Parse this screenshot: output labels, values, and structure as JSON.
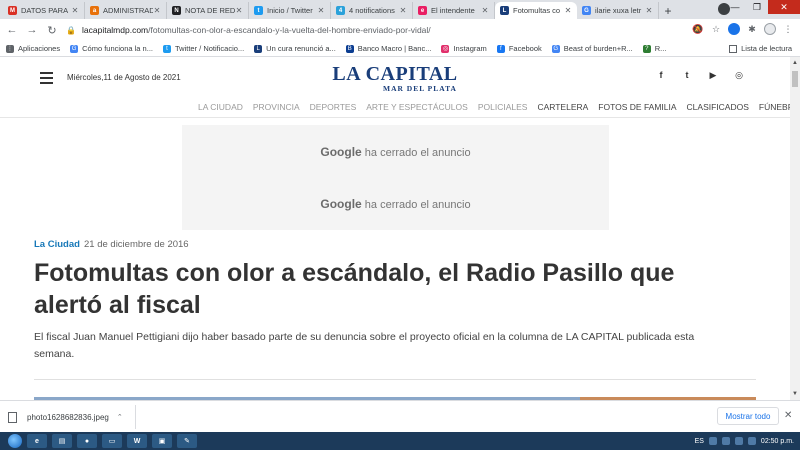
{
  "browser": {
    "tabs": [
      {
        "label": "DATOS PARA",
        "favicon_color": "#d93025",
        "favicon_char": "M",
        "active": false
      },
      {
        "label": "ADMINISTRAD",
        "favicon_color": "#e8710a",
        "favicon_char": "a",
        "active": false
      },
      {
        "label": "NOTA DE RED",
        "favicon_color": "#202124",
        "favicon_char": "N",
        "active": false
      },
      {
        "label": "Inicio / Twitter",
        "favicon_color": "#1d9bf0",
        "favicon_char": "t",
        "active": false
      },
      {
        "label": "4 notifications",
        "favicon_color": "#2aa1da",
        "favicon_char": "4",
        "active": false
      },
      {
        "label": "El intendente",
        "favicon_color": "#e91e63",
        "favicon_char": "e",
        "active": false
      },
      {
        "label": "Fotomultas co",
        "favicon_color": "#1a3e7a",
        "favicon_char": "L",
        "active": true
      },
      {
        "label": "ilarie xuxa letr",
        "favicon_color": "#4285f4",
        "favicon_char": "G",
        "active": false
      }
    ],
    "new_tab_label": "+",
    "url": {
      "host": "lacapitalmdp.com",
      "path": "/fotomultas-con-olor-a-escandalo-y-la-vuelta-del-hombre-enviado-por-vidal/"
    },
    "bookmarks": [
      {
        "label": "Aplicaciones",
        "color": "#5f6368",
        "char": "⋮"
      },
      {
        "label": "Cómo funciona la n...",
        "color": "#4285f4",
        "char": "G"
      },
      {
        "label": "Twitter / Notificacio...",
        "color": "#1d9bf0",
        "char": "t"
      },
      {
        "label": "Un cura renunció a...",
        "color": "#1a3e7a",
        "char": "L"
      },
      {
        "label": "Banco Macro | Banc...",
        "color": "#0b3d91",
        "char": "B"
      },
      {
        "label": "Instagram",
        "color": "#e1306c",
        "char": "◎"
      },
      {
        "label": "Facebook",
        "color": "#1877f2",
        "char": "f"
      },
      {
        "label": "Beast of burden+R...",
        "color": "#4285f4",
        "char": "G"
      },
      {
        "label": "R...",
        "color": "#2e7d32",
        "char": "?"
      }
    ],
    "reading_list_label": "Lista de lectura"
  },
  "page": {
    "date": "Miércoles,11 de Agosto de 2021",
    "logo_main": "LA CAPITAL",
    "logo_sub": "MAR DEL PLATA",
    "social": [
      "f",
      "t",
      "▶",
      "◎"
    ],
    "menu": [
      {
        "label": "LA CIUDAD",
        "dark": false
      },
      {
        "label": "PROVINCIA",
        "dark": false
      },
      {
        "label": "DEPORTES",
        "dark": false
      },
      {
        "label": "ARTE Y ESPECTÁCULOS",
        "dark": false
      },
      {
        "label": "POLICIALES",
        "dark": false
      },
      {
        "label": "CARTELERA",
        "dark": true
      },
      {
        "label": "FOTOS DE FAMILIA",
        "dark": true
      },
      {
        "label": "CLASIFICADOS",
        "dark": true
      },
      {
        "label": "FÚNEBRES",
        "dark": true
      }
    ],
    "ad": {
      "brand": "Google",
      "text": "ha cerrado el anuncio"
    },
    "article": {
      "category": "La Ciudad",
      "date": "21 de diciembre de 2016",
      "headline": "Fotomultas con olor a escándalo, el Radio Pasillo que alertó al fiscal",
      "lede": "El fiscal Juan Manuel Pettigiani dijo haber basado parte de su denuncia sobre el proyecto oficial en la columna de LA CAPITAL publicada esta semana."
    }
  },
  "downloads": {
    "file_name": "photo1628682836.jpeg",
    "show_all": "Mostrar todo"
  },
  "taskbar": {
    "language": "ES",
    "time": "02:50 p.m."
  }
}
